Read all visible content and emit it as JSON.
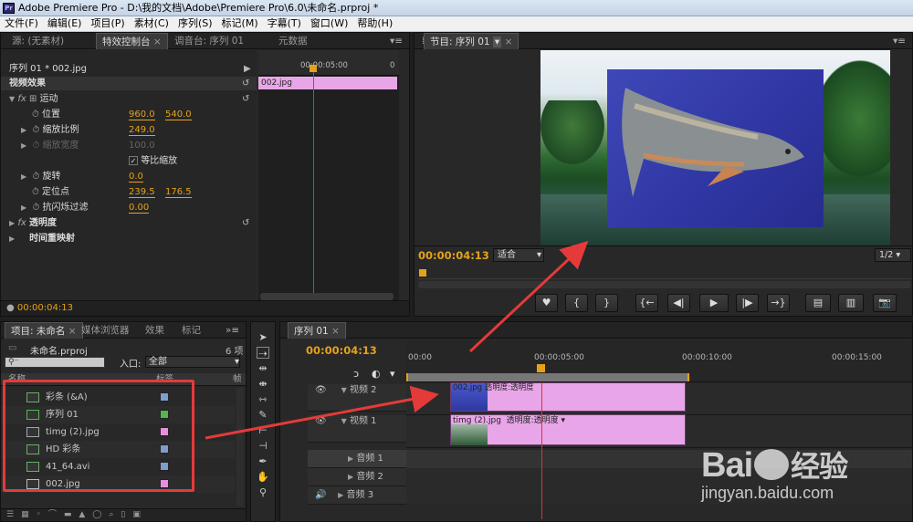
{
  "window": {
    "title": "Adobe Premiere Pro - D:\\我的文档\\Adobe\\Premiere Pro\\6.0\\未命名.prproj *",
    "app_icon": "Pr"
  },
  "menu": [
    "文件(F)",
    "编辑(E)",
    "项目(P)",
    "素材(C)",
    "序列(S)",
    "标记(M)",
    "字幕(T)",
    "窗口(W)",
    "帮助(H)"
  ],
  "source_panel": {
    "tabs": [
      "源: (无素材)",
      "特效控制台",
      "调音台: 序列 01",
      "元数据"
    ],
    "header": "序列 01 * 002.jpg",
    "ruler_time": "00:00:05:00",
    "ruler_zero": "0",
    "clip": "002.jpg",
    "video_effects": "视频效果",
    "motion": "运动",
    "position": {
      "label": "位置",
      "x": "960.0",
      "y": "540.0"
    },
    "scale": {
      "label": "缩放比例",
      "value": "249.0"
    },
    "scale_width": {
      "label": "缩放宽度",
      "value": "100.0"
    },
    "uniform": "等比缩放",
    "rotation": {
      "label": "旋转",
      "value": "0.0"
    },
    "anchor": {
      "label": "定位点",
      "x": "239.5",
      "y": "176.5"
    },
    "flicker": {
      "label": "抗闪烁过滤",
      "value": "0.00"
    },
    "opacity": "透明度",
    "time_remap": "时间重映射",
    "timecode": "00:00:04:13"
  },
  "program": {
    "tab": "节目: 序列 01",
    "timecode": "00:00:04:13",
    "fit": "适合",
    "fraction": "1/2"
  },
  "project": {
    "tabs": [
      "项目: 未命名",
      "媒体浏览器",
      "效果",
      "标记"
    ],
    "name": "未命名.prproj",
    "count": "6 项",
    "search_placeholder": "",
    "inlet_label": "入口:",
    "inlet_value": "全部",
    "col_name": "名称",
    "col_label": "标签",
    "col_rate": "帧",
    "items": [
      {
        "name": "彩条 (&A)",
        "color": "#7f9ccb"
      },
      {
        "name": "序列 01",
        "color": "#53b64f"
      },
      {
        "name": "timg (2).jpg",
        "color": "#e88ee2"
      },
      {
        "name": "HD 彩条",
        "color": "#7f9ccb"
      },
      {
        "name": "41_64.avi",
        "color": "#7f9ccb"
      },
      {
        "name": "002.jpg",
        "color": "#e88ee2"
      }
    ]
  },
  "timeline": {
    "tab": "序列 01",
    "timecode": "00:00:04:13",
    "ticks": [
      "00:00",
      "00:00:05:00",
      "00:00:10:00",
      "00:00:15:00"
    ],
    "tracks": {
      "v2": "视频 2",
      "v1": "视频 1",
      "a1": "音频 1",
      "a2": "音频 2",
      "a3": "音频 3"
    },
    "clip_v2": "002.jpg  透明度:透明度",
    "clip_v1_name": "timg (2).jpg",
    "clip_v1_fx": "透明度:透明度"
  },
  "watermark": {
    "brand": "Bai",
    "brand_cn": "经验",
    "url": "jingyan.baidu.com"
  },
  "accent": "#e4a21a",
  "annotation_red": "#e53a3a"
}
